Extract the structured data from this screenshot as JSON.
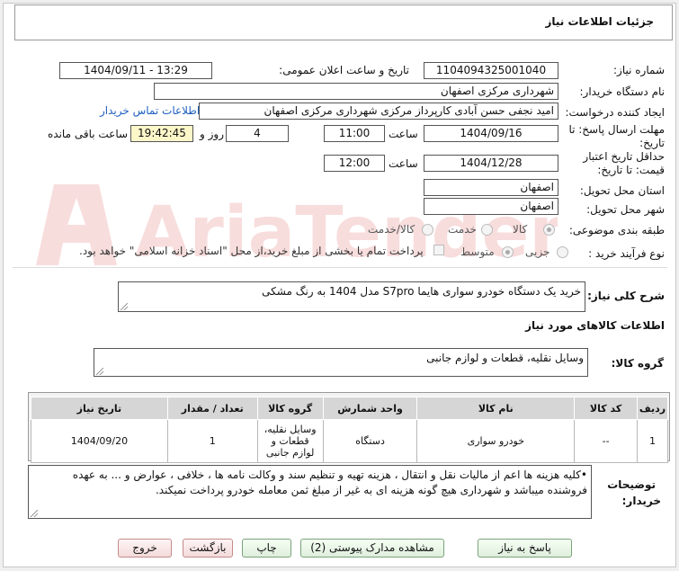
{
  "header": {
    "title": "جزئیات اطلاعات نیاز"
  },
  "form": {
    "need_number_label": "شماره نیاز:",
    "need_number": "1104094325001040",
    "announce_label": "تاریخ و ساعت اعلان عمومی:",
    "announce_value": "1404/09/11 - 13:29",
    "buyer_org_label": "نام دستگاه خریدار:",
    "buyer_org": "شهرداری مرکزی اصفهان",
    "requester_label": "ایجاد کننده درخواست:",
    "requester": "امید نجفی حسن آبادی کارپرداز مرکزی شهرداری مرکزی اصفهان",
    "contact_link": "اطلاعات تماس خریدار",
    "deadline_label": "مهلت ارسال پاسخ: تا تاریخ:",
    "deadline_date": "1404/09/16",
    "time_label": "ساعت",
    "deadline_time": "11:00",
    "days": "4",
    "days_label": "روز و",
    "remaining": "19:42:45",
    "remaining_label": "ساعت باقی مانده",
    "validity_label": "حداقل تاریخ اعتبار قیمت: تا تاریخ:",
    "validity_date": "1404/12/28",
    "validity_time": "12:00",
    "province_label": "استان محل تحویل:",
    "province": "اصفهان",
    "city_label": "شهر محل تحویل:",
    "city": "اصفهان",
    "category_label": "طبقه بندی موضوعی:",
    "category_options": [
      "کالا",
      "خدمت",
      "کالا/خدمت"
    ],
    "process_label": "نوع فرآیند خرید :",
    "process_options": [
      "جزیی",
      "متوسط"
    ],
    "payment_note": "پرداخت تمام یا بخشی از مبلغ خرید،از محل \"اسناد خزانه اسلامی\" خواهد بود."
  },
  "summary": {
    "label": "شرح کلی نیاز:",
    "text": "خرید یک دستگاه خودرو سواری هایما S7pro  مدل 1404 به رنگ مشکی"
  },
  "goods": {
    "section_title": "اطلاعات کالاهای مورد نیاز",
    "group_label": "گروه کالا:",
    "group_value": "وسایل نقلیه، قطعات و لوازم جانبی"
  },
  "table": {
    "headers": [
      "ردیف",
      "کد کالا",
      "نام کالا",
      "واحد شمارش",
      "گروه کالا",
      "تعداد / مقدار",
      "تاریخ نیاز"
    ],
    "rows": [
      [
        "1",
        "--",
        "خودرو سواری",
        "دستگاه",
        "وسایل نقلیه، قطعات و لوازم جانبی",
        "1",
        "1404/09/20"
      ]
    ]
  },
  "notes": {
    "label_line1": "توضیحات",
    "label_line2": "خریدار:",
    "text": "•کلیه هزینه ها اعم از مالیات نقل و انتقال ، هزینه تهیه و تنظیم سند و وکالت نامه ها ، خلافی ، عوارض و ... به عهده فروشنده میباشد و شهرداری هیچ گونه هزینه ای به غیر از مبلغ ثمن معامله خودرو پرداخت نمیکند."
  },
  "buttons": {
    "reply": "پاسخ به نیاز",
    "attachments": "مشاهده مدارک پیوستی (2)",
    "print": "چاپ",
    "back": "بازگشت",
    "exit": "خروج"
  },
  "watermark": "AriaTender.net"
}
